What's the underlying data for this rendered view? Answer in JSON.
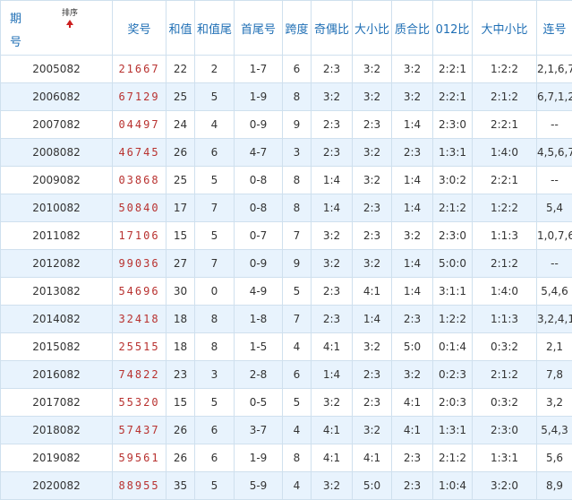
{
  "header": {
    "period": "期号",
    "sort": "排序",
    "columns": [
      "奖号",
      "和值",
      "和值尾",
      "首尾号",
      "跨度",
      "奇偶比",
      "大小比",
      "质合比",
      "012比",
      "大中小比",
      "连号"
    ]
  },
  "rows": [
    {
      "period": "2005082",
      "number": "21667",
      "sum": "22",
      "sum_tail": "2",
      "first_last": "1-7",
      "span": "6",
      "odd_even": "2:3",
      "big_small": "3:2",
      "prime_comp": "3:2",
      "r012": "2:2:1",
      "bms": "1:2:2",
      "consec": "2,1,6,7"
    },
    {
      "period": "2006082",
      "number": "67129",
      "sum": "25",
      "sum_tail": "5",
      "first_last": "1-9",
      "span": "8",
      "odd_even": "3:2",
      "big_small": "3:2",
      "prime_comp": "3:2",
      "r012": "2:2:1",
      "bms": "2:1:2",
      "consec": "6,7,1,2"
    },
    {
      "period": "2007082",
      "number": "04497",
      "sum": "24",
      "sum_tail": "4",
      "first_last": "0-9",
      "span": "9",
      "odd_even": "2:3",
      "big_small": "2:3",
      "prime_comp": "1:4",
      "r012": "2:3:0",
      "bms": "2:2:1",
      "consec": "--"
    },
    {
      "period": "2008082",
      "number": "46745",
      "sum": "26",
      "sum_tail": "6",
      "first_last": "4-7",
      "span": "3",
      "odd_even": "2:3",
      "big_small": "3:2",
      "prime_comp": "2:3",
      "r012": "1:3:1",
      "bms": "1:4:0",
      "consec": "4,5,6,7"
    },
    {
      "period": "2009082",
      "number": "03868",
      "sum": "25",
      "sum_tail": "5",
      "first_last": "0-8",
      "span": "8",
      "odd_even": "1:4",
      "big_small": "3:2",
      "prime_comp": "1:4",
      "r012": "3:0:2",
      "bms": "2:2:1",
      "consec": "--"
    },
    {
      "period": "2010082",
      "number": "50840",
      "sum": "17",
      "sum_tail": "7",
      "first_last": "0-8",
      "span": "8",
      "odd_even": "1:4",
      "big_small": "2:3",
      "prime_comp": "1:4",
      "r012": "2:1:2",
      "bms": "1:2:2",
      "consec": "5,4"
    },
    {
      "period": "2011082",
      "number": "17106",
      "sum": "15",
      "sum_tail": "5",
      "first_last": "0-7",
      "span": "7",
      "odd_even": "3:2",
      "big_small": "2:3",
      "prime_comp": "3:2",
      "r012": "2:3:0",
      "bms": "1:1:3",
      "consec": "1,0,7,6"
    },
    {
      "period": "2012082",
      "number": "99036",
      "sum": "27",
      "sum_tail": "7",
      "first_last": "0-9",
      "span": "9",
      "odd_even": "3:2",
      "big_small": "3:2",
      "prime_comp": "1:4",
      "r012": "5:0:0",
      "bms": "2:1:2",
      "consec": "--"
    },
    {
      "period": "2013082",
      "number": "54696",
      "sum": "30",
      "sum_tail": "0",
      "first_last": "4-9",
      "span": "5",
      "odd_even": "2:3",
      "big_small": "4:1",
      "prime_comp": "1:4",
      "r012": "3:1:1",
      "bms": "1:4:0",
      "consec": "5,4,6"
    },
    {
      "period": "2014082",
      "number": "32418",
      "sum": "18",
      "sum_tail": "8",
      "first_last": "1-8",
      "span": "7",
      "odd_even": "2:3",
      "big_small": "1:4",
      "prime_comp": "2:3",
      "r012": "1:2:2",
      "bms": "1:1:3",
      "consec": "3,2,4,1"
    },
    {
      "period": "2015082",
      "number": "25515",
      "sum": "18",
      "sum_tail": "8",
      "first_last": "1-5",
      "span": "4",
      "odd_even": "4:1",
      "big_small": "3:2",
      "prime_comp": "5:0",
      "r012": "0:1:4",
      "bms": "0:3:2",
      "consec": "2,1"
    },
    {
      "period": "2016082",
      "number": "74822",
      "sum": "23",
      "sum_tail": "3",
      "first_last": "2-8",
      "span": "6",
      "odd_even": "1:4",
      "big_small": "2:3",
      "prime_comp": "3:2",
      "r012": "0:2:3",
      "bms": "2:1:2",
      "consec": "7,8"
    },
    {
      "period": "2017082",
      "number": "55320",
      "sum": "15",
      "sum_tail": "5",
      "first_last": "0-5",
      "span": "5",
      "odd_even": "3:2",
      "big_small": "2:3",
      "prime_comp": "4:1",
      "r012": "2:0:3",
      "bms": "0:3:2",
      "consec": "3,2"
    },
    {
      "period": "2018082",
      "number": "57437",
      "sum": "26",
      "sum_tail": "6",
      "first_last": "3-7",
      "span": "4",
      "odd_even": "4:1",
      "big_small": "3:2",
      "prime_comp": "4:1",
      "r012": "1:3:1",
      "bms": "2:3:0",
      "consec": "5,4,3"
    },
    {
      "period": "2019082",
      "number": "59561",
      "sum": "26",
      "sum_tail": "6",
      "first_last": "1-9",
      "span": "8",
      "odd_even": "4:1",
      "big_small": "4:1",
      "prime_comp": "2:3",
      "r012": "2:1:2",
      "bms": "1:3:1",
      "consec": "5,6"
    },
    {
      "period": "2020082",
      "number": "88955",
      "sum": "35",
      "sum_tail": "5",
      "first_last": "5-9",
      "span": "4",
      "odd_even": "3:2",
      "big_small": "5:0",
      "prime_comp": "2:3",
      "r012": "1:0:4",
      "bms": "3:2:0",
      "consec": "8,9"
    }
  ]
}
